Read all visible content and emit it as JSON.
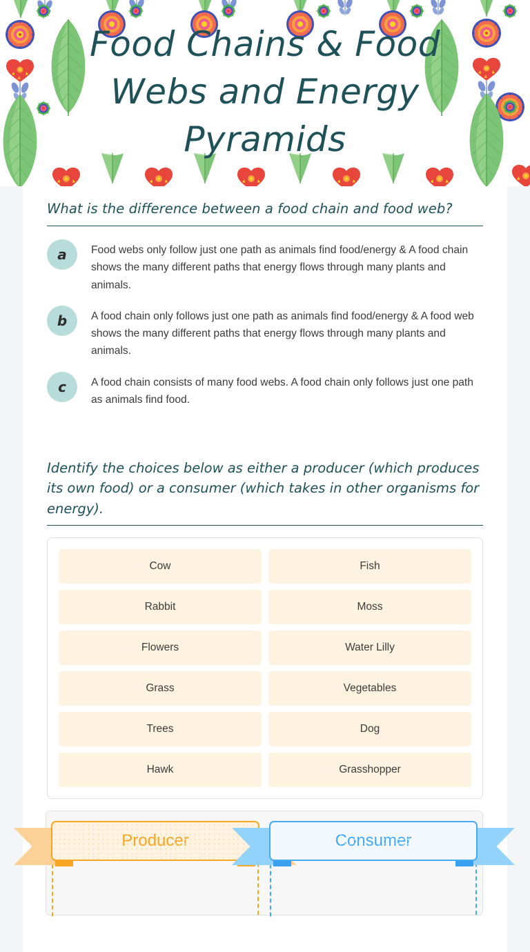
{
  "header": {
    "title": "Food Chains & Food Webs and Energy Pyramids",
    "title_color": "#1f5159",
    "pattern_name": "watercolor-folk-flowers-and-leaves"
  },
  "question1": {
    "heading": "What is the difference between a food chain and food web?",
    "choices": [
      {
        "letter": "a",
        "text": "Food webs only follow just one path as animals find food/energy & A food chain shows the many different paths that energy flows through many plants and animals."
      },
      {
        "letter": "b",
        "text": "A food chain only follows just one path as animals find food/energy & A food web shows the many different paths that energy flows through many plants and animals."
      },
      {
        "letter": "c",
        "text": "A food chain consists of many food webs. A food chain only follows just one path as animals find food."
      }
    ],
    "bullet_color": "#b7dcd9"
  },
  "question2": {
    "prompt": "Identify the choices below as either a producer (which produces its own food) or a consumer (which takes in other organisms for energy).",
    "word_bank": [
      "Cow",
      "Fish",
      "Rabbit",
      "Moss",
      "Flowers",
      "Water Lilly",
      "Grass",
      "Vegetables",
      "Trees",
      "Dog",
      "Hawk",
      "Grasshopper"
    ],
    "tile_color": "#fdf3e0",
    "categories": [
      {
        "label": "Producer",
        "accent": "#f5a623"
      },
      {
        "label": "Consumer",
        "accent": "#43a9f5"
      }
    ]
  }
}
